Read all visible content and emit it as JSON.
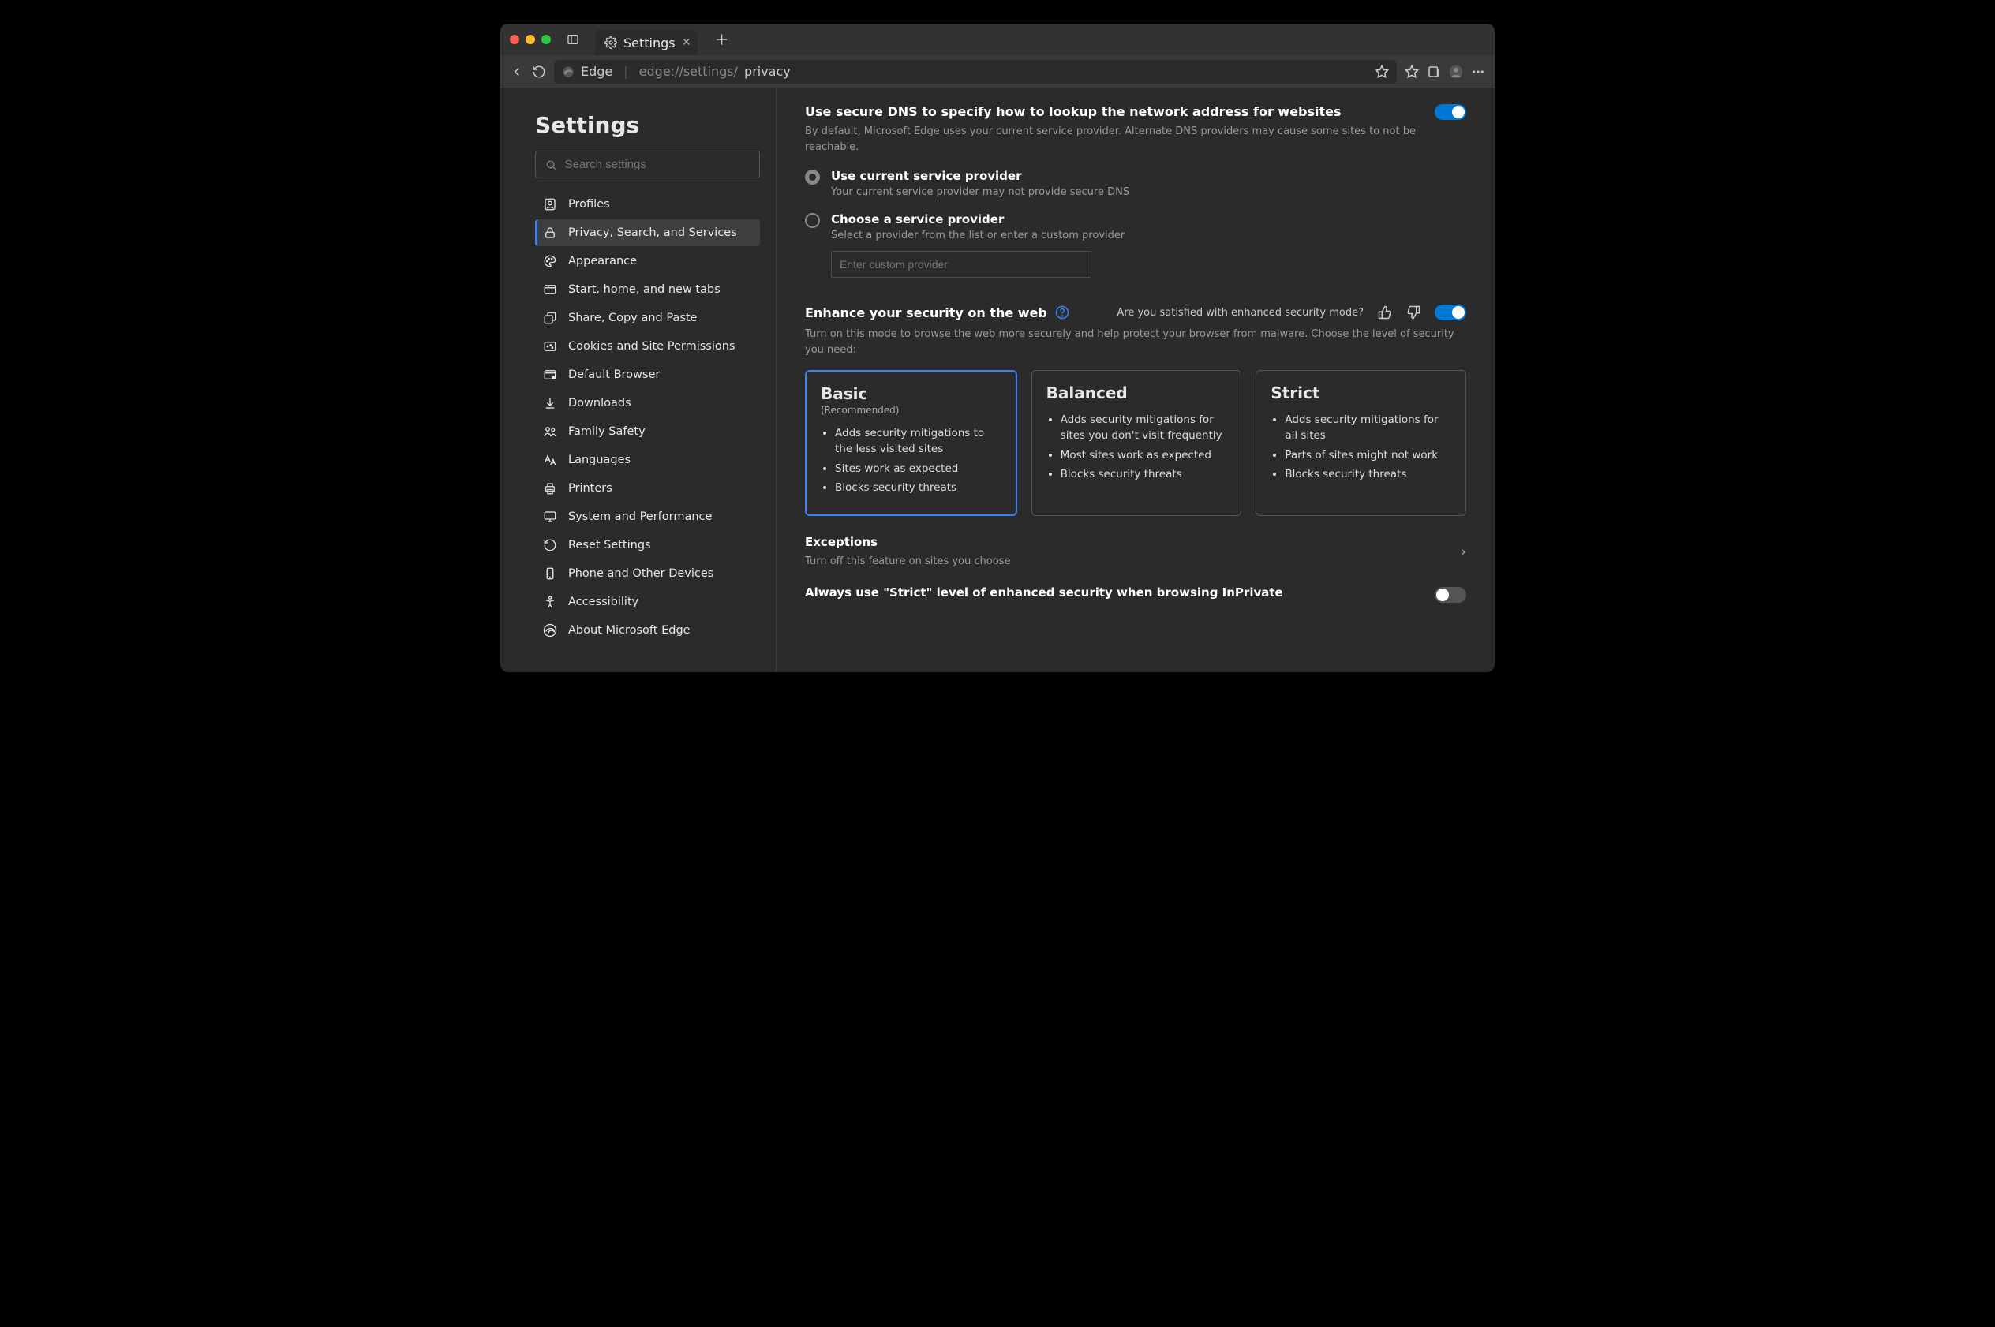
{
  "window": {
    "tab_title": "Settings",
    "browser_name": "Edge",
    "url_prefix": "edge://settings/",
    "url_path": "privacy"
  },
  "sidebar": {
    "heading": "Settings",
    "search_placeholder": "Search settings",
    "items": [
      {
        "label": "Profiles"
      },
      {
        "label": "Privacy, Search, and Services"
      },
      {
        "label": "Appearance"
      },
      {
        "label": "Start, home, and new tabs"
      },
      {
        "label": "Share, Copy and Paste"
      },
      {
        "label": "Cookies and Site Permissions"
      },
      {
        "label": "Default Browser"
      },
      {
        "label": "Downloads"
      },
      {
        "label": "Family Safety"
      },
      {
        "label": "Languages"
      },
      {
        "label": "Printers"
      },
      {
        "label": "System and Performance"
      },
      {
        "label": "Reset Settings"
      },
      {
        "label": "Phone and Other Devices"
      },
      {
        "label": "Accessibility"
      },
      {
        "label": "About Microsoft Edge"
      }
    ]
  },
  "dns": {
    "title": "Use secure DNS to specify how to lookup the network address for websites",
    "desc": "By default, Microsoft Edge uses your current service provider. Alternate DNS providers may cause some sites to not be reachable.",
    "opt1_title": "Use current service provider",
    "opt1_sub": "Your current service provider may not provide secure DNS",
    "opt2_title": "Choose a service provider",
    "opt2_sub": "Select a provider from the list or enter a custom provider",
    "custom_placeholder": "Enter custom provider"
  },
  "enhance": {
    "title": "Enhance your security on the web",
    "feedback_q": "Are you satisfied with enhanced security mode?",
    "desc": "Turn on this mode to browse the web more securely and help protect your browser from malware. Choose the level of security you need:",
    "cards": [
      {
        "name": "Basic",
        "tag": "(Recommended)",
        "points": [
          "Adds security mitigations to the less visited sites",
          "Sites work as expected",
          "Blocks security threats"
        ]
      },
      {
        "name": "Balanced",
        "tag": "",
        "points": [
          "Adds security mitigations for sites you don't visit frequently",
          "Most sites work as expected",
          "Blocks security threats"
        ]
      },
      {
        "name": "Strict",
        "tag": "",
        "points": [
          "Adds security mitigations for all sites",
          "Parts of sites might not work",
          "Blocks security threats"
        ]
      }
    ],
    "exceptions_title": "Exceptions",
    "exceptions_sub": "Turn off this feature on sites you choose",
    "always_strict": "Always use \"Strict\" level of enhanced security when browsing InPrivate"
  }
}
